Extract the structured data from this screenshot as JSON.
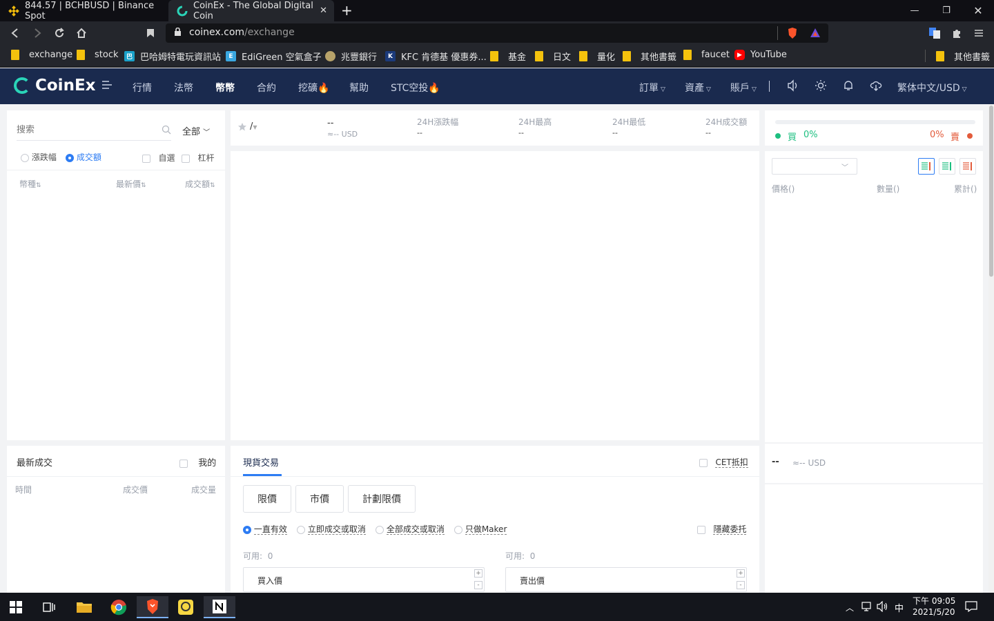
{
  "browser": {
    "tabs": [
      {
        "title": "844.57 | BCHBUSD | Binance Spot"
      },
      {
        "title": "CoinEx - The Global Digital Coin"
      }
    ],
    "url_host": "coinex.com",
    "url_path": "/exchange",
    "bookmarks": [
      "exchange",
      "stock",
      "巴哈姆特電玩資訊站",
      "EdiGreen 空氣盒子",
      "兆豐銀行",
      "KFC 肯德基 優惠券...",
      "基金",
      "日文",
      "量化",
      "其他書籤",
      "faucet",
      "YouTube",
      "其他書籤"
    ]
  },
  "header": {
    "logo": "CoinEx",
    "nav": [
      "行情",
      "法幣",
      "幣幣",
      "合約",
      "挖礦",
      "幫助",
      "STC空投"
    ],
    "right": [
      "訂單",
      "資產",
      "賬戶",
      "繁体中文/USD"
    ]
  },
  "market": {
    "search_placeholder": "搜索",
    "filter": "全部",
    "sort_change": "漲跌幅",
    "sort_volume": "成交額",
    "favorites": "自選",
    "leverage": "杠杆",
    "col_coin": "幣種",
    "col_price": "最新價",
    "col_volume": "成交額"
  },
  "ticker": {
    "pair": "/",
    "price": "--",
    "price_usd": "≈-- USD",
    "change_label": "24H漲跌幅",
    "change_value": "--",
    "high_label": "24H最高",
    "high_value": "--",
    "low_label": "24H最低",
    "low_value": "--",
    "volume_label": "24H成交額",
    "volume_value": "--"
  },
  "orderbook": {
    "buy_label": "買",
    "buy_pct": "0%",
    "sell_pct": "0%",
    "sell_label": "賣",
    "col_price": "價格()",
    "col_amount": "數量()",
    "col_total": "累計()",
    "last_price": "--",
    "last_usd": "≈-- USD"
  },
  "trades": {
    "title": "最新成交",
    "mine": "我的",
    "col_time": "時間",
    "col_price": "成交價",
    "col_amount": "成交量"
  },
  "trade_form": {
    "tab": "現貨交易",
    "cet": "CET抵扣",
    "types": [
      "限價",
      "市價",
      "計劃限價"
    ],
    "tif": [
      "一直有效",
      "立即成交或取消",
      "全部成交或取消",
      "只做Maker"
    ],
    "hidden": "隱藏委托",
    "available_label": "可用:",
    "available_buy": "0",
    "available_sell": "0",
    "buy_price": "買入價",
    "sell_price": "賣出價"
  },
  "system": {
    "ime": "中",
    "time": "下午 09:05",
    "date": "2021/5/20"
  },
  "colors": {
    "brand": "#1a2a4e",
    "accent": "#2ad4b8",
    "buy": "#1dbf80",
    "sell": "#e35b3b",
    "primary": "#2d7cf3"
  }
}
